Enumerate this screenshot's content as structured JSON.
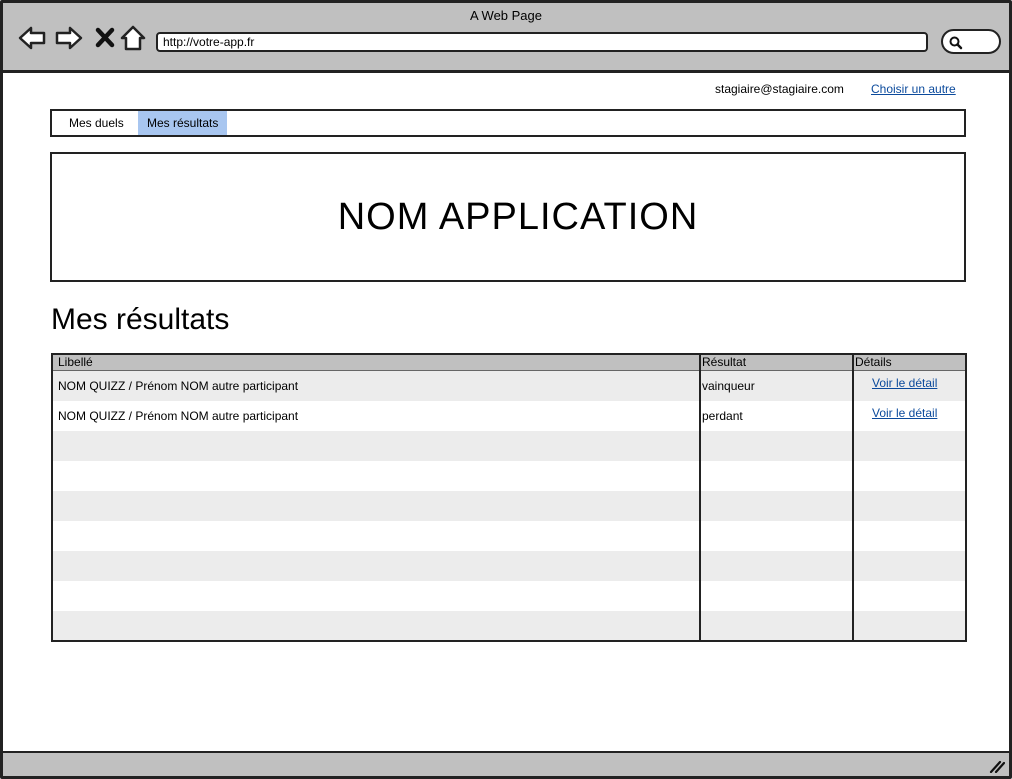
{
  "window": {
    "title": "A Web Page",
    "url": "http://votre-app.fr"
  },
  "header": {
    "user_email": "stagiaire@stagiaire.com",
    "choose_other": "Choisir un autre"
  },
  "tabs": [
    {
      "label": "Mes duels",
      "active": false
    },
    {
      "label": "Mes résultats",
      "active": true
    }
  ],
  "banner": {
    "title": "NOM APPLICATION"
  },
  "section": {
    "title": "Mes résultats"
  },
  "table": {
    "columns": [
      "Libellé",
      "Résultat",
      "Détails"
    ],
    "rows": [
      {
        "libelle": "NOM QUIZZ / Prénom NOM autre participant",
        "resultat": "vainqueur",
        "details": "Voir le détail"
      },
      {
        "libelle": "NOM QUIZZ / Prénom NOM autre participant",
        "resultat": "perdant",
        "details": "Voir le détail"
      }
    ]
  },
  "icons": [
    "back-arrow-icon",
    "forward-arrow-icon",
    "close-icon",
    "home-icon",
    "search-icon",
    "resize-handle-icon"
  ],
  "colors": {
    "chrome": "#c0c0c0",
    "active_tab": "#a8c6f0",
    "link": "#0b4a9c",
    "row_alt": "#ececec"
  }
}
